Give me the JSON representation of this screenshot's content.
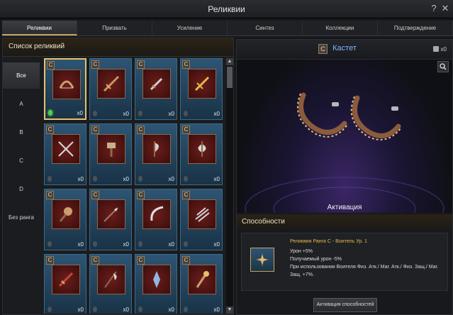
{
  "window": {
    "title": "Реликвии",
    "help_label": "?",
    "close_label": "✕"
  },
  "tabs": [
    {
      "label": "Реликвии",
      "active": true
    },
    {
      "label": "Призвать"
    },
    {
      "label": "Усиление"
    },
    {
      "label": "Синтез"
    },
    {
      "label": "Коллекции"
    },
    {
      "label": "Подтверждение"
    }
  ],
  "list": {
    "header": "Список реликвий",
    "filters": [
      {
        "label": "Все",
        "active": true
      },
      {
        "label": "A"
      },
      {
        "label": "B"
      },
      {
        "label": "C"
      },
      {
        "label": "D"
      },
      {
        "label": "Без ранга"
      }
    ],
    "items": [
      {
        "grade": "C",
        "count": "x0",
        "icon": "bow-icon",
        "selected": true,
        "gem": "green"
      },
      {
        "grade": "C",
        "count": "x0",
        "icon": "sword-icon"
      },
      {
        "grade": "C",
        "count": "x0",
        "icon": "dagger-icon"
      },
      {
        "grade": "C",
        "count": "x0",
        "icon": "golden-sword-icon"
      },
      {
        "grade": "C",
        "count": "x0",
        "icon": "crossed-swords-icon"
      },
      {
        "grade": "C",
        "count": "x0",
        "icon": "hammer-icon"
      },
      {
        "grade": "C",
        "count": "x0",
        "icon": "axe-icon"
      },
      {
        "grade": "C",
        "count": "x0",
        "icon": "double-axe-icon"
      },
      {
        "grade": "C",
        "count": "x0",
        "icon": "mace-icon"
      },
      {
        "grade": "C",
        "count": "x0",
        "icon": "spear-icon"
      },
      {
        "grade": "C",
        "count": "x0",
        "icon": "scimitar-icon"
      },
      {
        "grade": "C",
        "count": "x0",
        "icon": "claw-icon"
      },
      {
        "grade": "C",
        "count": "x0",
        "icon": "blade-icon"
      },
      {
        "grade": "C",
        "count": "x0",
        "icon": "halberd-icon"
      },
      {
        "grade": "C",
        "count": "x0",
        "icon": "lance-icon"
      },
      {
        "grade": "C",
        "count": "x0",
        "icon": "staff-icon"
      }
    ],
    "scroll_up": "▲",
    "scroll_down": "▼"
  },
  "detail": {
    "grade": "C",
    "title": "Кастет",
    "owned": "x0",
    "zoom_icon": "magnifier-icon",
    "activation_label": "Активация",
    "abilities_header": "Способности",
    "ability": {
      "title": "Реликвия Ранга C - Воитель Ур. 1",
      "lines": [
        "Урон +5%",
        "Получаемый урон -5%",
        "При использовании Воителя Физ. Атк./ Маг. Атк./ Физ. Защ./ Маг. Защ. +7%."
      ]
    },
    "activate_button": "Активация способностей"
  },
  "colors": {
    "accent": "#c9a25e",
    "title_blue": "#7cb7ff",
    "ability_gold": "#e4b84a"
  }
}
